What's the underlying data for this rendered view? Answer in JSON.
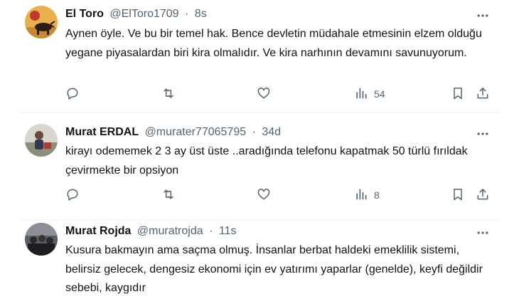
{
  "tweets": [
    {
      "name": "El Toro",
      "handle": "@ElToro1709",
      "sep": "·",
      "time": "8s",
      "text": "Aynen öyle. Ve bu bir temel hak. Bence devletin müdahale etmesinin elzem olduğu yegane piyasalardan biri kira olmalıdır. Ve kira narhının devamını savunuyorum.",
      "views": "54"
    },
    {
      "name": "Murat ERDAL",
      "handle": "@murater77065795",
      "sep": "·",
      "time": "34d",
      "text": "kirayı odememek 2 3 ay üst üste ..aradığında telefonu kapatmak 50 türlü fırıldak çevirmekte bir opsiyon",
      "views": "8"
    },
    {
      "name": "Murat Rojda",
      "handle": "@muratrojda",
      "sep": "·",
      "time": "11s",
      "text": "Kusura bakmayın ama saçma olmuş. İnsanlar berbat haldeki emeklilik sistemi, belirsiz gelecek, dengesiz ekonomi için ev yatırımı yaparlar (genelde), keyfi değildir sebebi, kaygıdır"
    }
  ],
  "icons": {
    "reply": "reply-icon",
    "retweet": "retweet-icon",
    "like": "heart-icon",
    "views": "views-icon",
    "bookmark": "bookmark-icon",
    "share": "share-icon",
    "more": "more-icon"
  },
  "colors": {
    "text": "#0f1419",
    "secondary": "#536471",
    "divider": "#eff3f4"
  }
}
